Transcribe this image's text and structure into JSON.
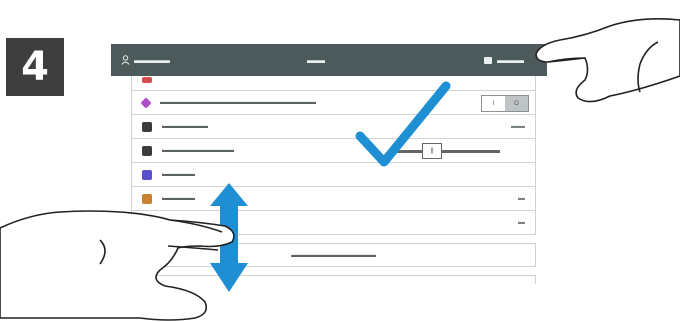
{
  "step": {
    "number": "4"
  },
  "header": {
    "left_label": "▬▬▬▬",
    "center_label": "▬▬",
    "right_label": "▬▬▬"
  },
  "rows": [
    {
      "label": "",
      "value": ""
    },
    {
      "label": "▬▬▬▬▬▬▬▬▬▬▬▬▬▬▬▬▬▬▬▬▬▬▬▬",
      "value": ""
    },
    {
      "label": "▬▬▬▬▬▬▬",
      "value": "▬▬"
    },
    {
      "label": "▬▬▬▬▬▬▬▬▬▬▬",
      "value": ""
    },
    {
      "label": "▬▬▬▬▬",
      "value": ""
    },
    {
      "label": "▬▬▬▬▬",
      "value": "▬"
    },
    {
      "label": "",
      "value": "▬"
    }
  ],
  "toggle": {
    "on_label": "I",
    "off_label": "O"
  },
  "slider": {
    "thumb_label": "||"
  },
  "bottom_button": {
    "label": "▬▬▬▬▬▬▬▬▬▬▬▬▬"
  },
  "colors": {
    "header_bg": "#4d5a5b",
    "checkmark": "#1f8fd3",
    "scroll_arrow": "#1f8fd3",
    "step_badge": "#3e3e3e",
    "icon_colors": [
      "#d64a4a",
      "#b04fc8",
      "#3c3c3c",
      "#3c3c3c",
      "#5a4fcf",
      "#c9822f"
    ]
  },
  "icons": {
    "checkmark": "check-icon",
    "scroll": "up-down-arrow-icon",
    "hand_right": "hand-pointer-icon",
    "hand_left": "hand-swipe-icon",
    "user": "user-icon",
    "login": "login-icon"
  }
}
